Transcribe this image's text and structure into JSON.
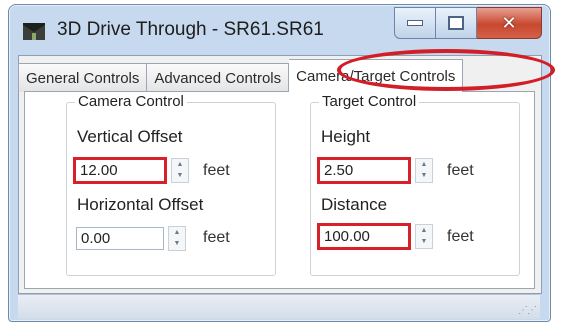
{
  "window": {
    "title": "3D Drive Through - SR61.SR61",
    "close_glyph": "✕"
  },
  "tabs": [
    {
      "label": "General Controls"
    },
    {
      "label": "Advanced Controls"
    },
    {
      "label": "Camera/Target Controls"
    }
  ],
  "camera_control": {
    "label": "Camera Control",
    "vertical_offset_label": "Vertical Offset",
    "vertical_offset_value": "12.00",
    "horizontal_offset_label": "Horizontal Offset",
    "horizontal_offset_value": "0.00",
    "unit": "feet"
  },
  "target_control": {
    "label": "Target Control",
    "height_label": "Height",
    "height_value": "2.50",
    "distance_label": "Distance",
    "distance_value": "100.00",
    "unit": "feet"
  },
  "spinner": {
    "up": "▲",
    "down": "▼"
  },
  "statusbar": {
    "grip": "⋰⋰"
  },
  "colors": {
    "highlight": "#d8202a",
    "close_button": "#c8482f"
  }
}
